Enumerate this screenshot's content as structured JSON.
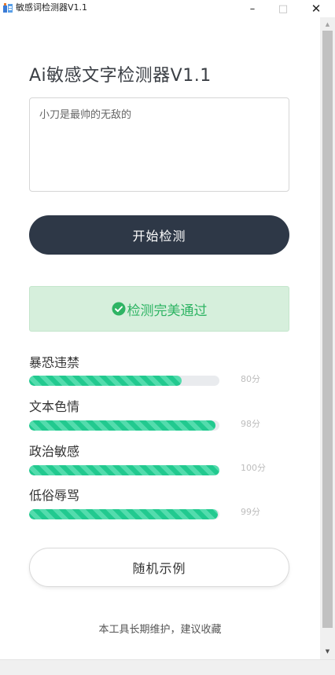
{
  "window": {
    "title": "敏感词检测器V1.1",
    "minimize_glyph": "–",
    "maximize_glyph": "□",
    "close_glyph": "✕"
  },
  "main": {
    "title": "Ai敏感文字检测器V1.1",
    "input_value": "小刀是最帅的无敌的",
    "start_button": "开始检测",
    "result_text": "检测完美通过",
    "categories": [
      {
        "label": "暴恐违禁",
        "score_text": "80分",
        "value": 80
      },
      {
        "label": "文本色情",
        "score_text": "98分",
        "value": 98
      },
      {
        "label": "政治敏感",
        "score_text": "100分",
        "value": 100
      },
      {
        "label": "低俗辱骂",
        "score_text": "99分",
        "value": 99
      }
    ],
    "random_button": "随机示例",
    "footer": "本工具长期维护，建议收藏"
  },
  "colors": {
    "button_dark": "#2e3847",
    "success_bg": "#d6efdc",
    "success_text": "#2fb464",
    "bar_fill": "#22c98f",
    "bar_track": "#e9ebee"
  },
  "icons": {
    "app": "app-icon",
    "result": "check-circle-icon",
    "scroll_up": "arrow-up-icon",
    "scroll_down": "arrow-down-icon"
  }
}
